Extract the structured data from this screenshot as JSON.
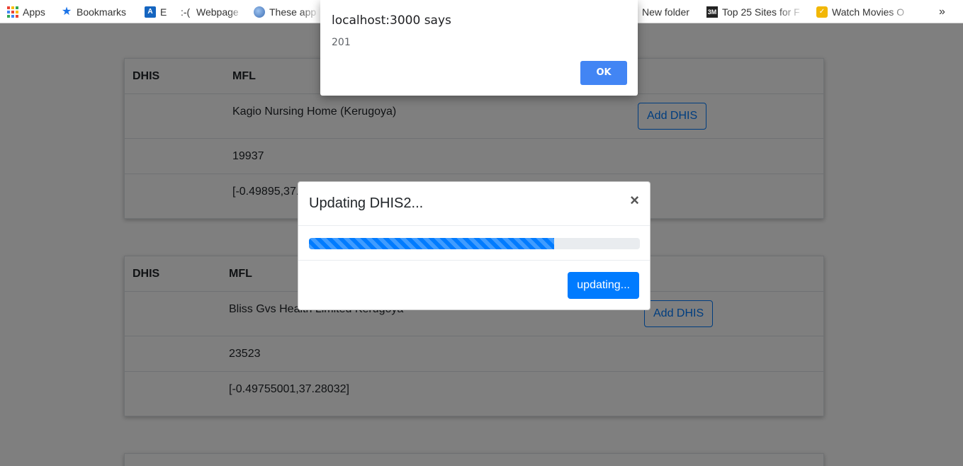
{
  "bookmarks": [
    {
      "label": "Apps",
      "icon": "apps-grid-icon"
    },
    {
      "label": "Bookmarks",
      "icon": "star-icon"
    },
    {
      "label": "E",
      "icon": "e-icon"
    },
    {
      "label": ":-(",
      "icon": ""
    },
    {
      "label": "Webpage",
      "icon": ""
    },
    {
      "label": "These app",
      "icon": "globe-icon"
    },
    {
      "label": "New folder",
      "icon": ""
    },
    {
      "label": "Top 25 Sites for F",
      "icon": "3m-icon"
    },
    {
      "label": "Watch Movies O",
      "icon": "yellow-bookmark-icon"
    },
    {
      "label": "»",
      "icon": "more-bookmarks-icon"
    }
  ],
  "cards": [
    {
      "headers": [
        "DHIS",
        "MFL"
      ],
      "name": "Kagio Nursing Home (Kerugoya)",
      "button": "Add DHIS",
      "code": "19937",
      "coords": "[-0.49895,37."
    },
    {
      "headers": [
        "DHIS",
        "MFL"
      ],
      "name": "Bliss Gvs Health Limited Kerugoya",
      "button": "Add DHIS",
      "code": "23523",
      "coords": "[-0.49755001,37.28032]"
    }
  ],
  "modal": {
    "title": "Updating DHIS2...",
    "close": "×",
    "progress": 0.74,
    "button": "updating..."
  },
  "alert": {
    "title": "localhost:3000 says",
    "message": "201",
    "ok": "OK"
  },
  "colors": {
    "primary": "#007bff",
    "alert_ok": "#4285f4"
  }
}
